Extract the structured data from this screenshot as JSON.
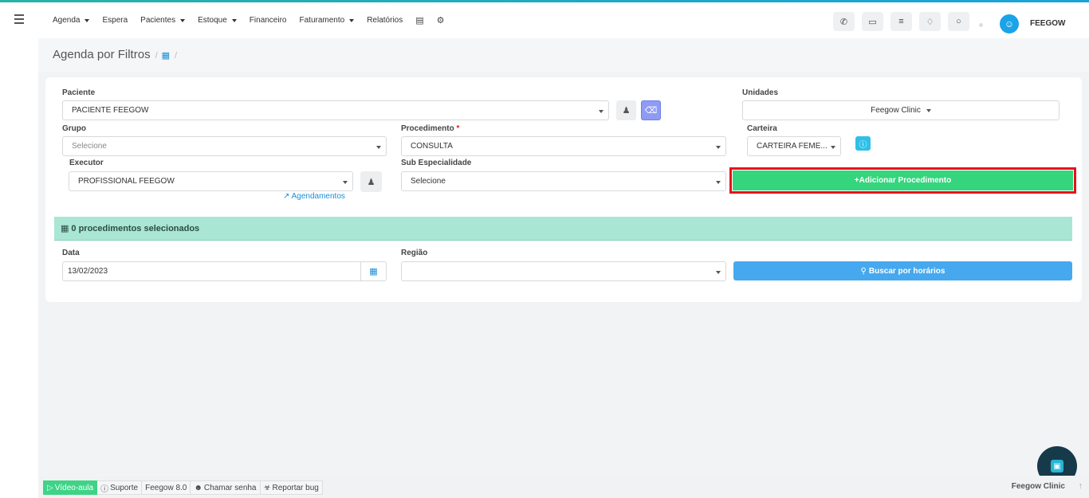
{
  "nav": {
    "items": [
      {
        "label": "Agenda",
        "caret": true
      },
      {
        "label": "Espera",
        "caret": false
      },
      {
        "label": "Pacientes",
        "caret": true
      },
      {
        "label": "Estoque",
        "caret": true
      },
      {
        "label": "Financeiro",
        "caret": false
      },
      {
        "label": "Faturamento",
        "caret": true
      },
      {
        "label": "Relatórios",
        "caret": false
      }
    ],
    "username": "FEEGOW"
  },
  "header": {
    "title": "Agenda por Filtros"
  },
  "form": {
    "paciente_label": "Paciente",
    "paciente_value": "PACIENTE FEEGOW",
    "unidades_label": "Unidades",
    "unidades_value": "Feegow Clinic",
    "grupo_label": "Grupo",
    "grupo_placeholder": "Selecione",
    "procedimento_label": "Procedimento",
    "procedimento_required": "*",
    "procedimento_value": "CONSULTA",
    "carteira_label": "Carteira",
    "carteira_value": "CARTEIRA FEME...",
    "executor_label": "Executor",
    "executor_value": "PROFISSIONAL FEEGOW",
    "agendamentos_link": "Agendamentos",
    "subespecialidade_label": "Sub Especialidade",
    "subespecialidade_value": "Selecione",
    "add_button": "Adicionar Procedimento",
    "summary": "0 procedimentos selecionados",
    "data_label": "Data",
    "data_value": "13/02/2023",
    "regiao_label": "Região",
    "search_button": "Buscar por horários"
  },
  "footer": {
    "video": "Vídeo-aula",
    "suporte": "Suporte",
    "version": "Feegow 8.0",
    "chamar": "Chamar senha",
    "bug": "Reportar bug",
    "brand": "Feegow Clinic"
  }
}
